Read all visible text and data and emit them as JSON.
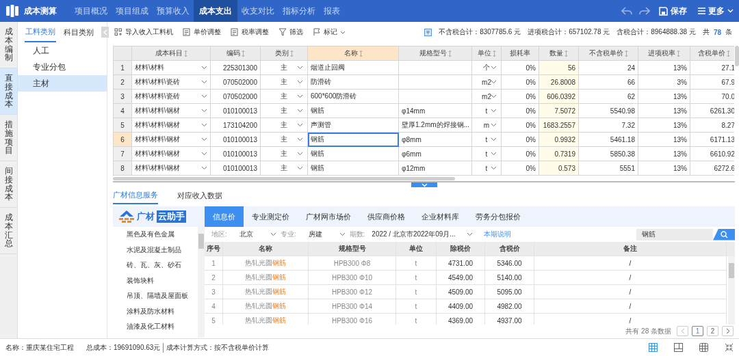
{
  "app": {
    "title": "成本测算"
  },
  "nav": [
    {
      "label": "项目概况",
      "selected": false
    },
    {
      "label": "项目组成",
      "selected": false
    },
    {
      "label": "预算收入",
      "selected": false
    },
    {
      "label": "成本支出",
      "selected": true
    },
    {
      "label": "收支对比",
      "selected": false
    },
    {
      "label": "指标分析",
      "selected": false
    },
    {
      "label": "报表",
      "selected": false
    }
  ],
  "actions": {
    "save": "保存",
    "more": "更多"
  },
  "side_tabs": [
    {
      "label": "成本编制",
      "selected": false
    },
    {
      "label": "直接成本",
      "selected": true
    },
    {
      "label": "措施项目",
      "selected": false
    },
    {
      "label": "间接成本",
      "selected": false
    },
    {
      "label": "成本汇总",
      "selected": false
    }
  ],
  "category_tabs": [
    {
      "label": "工料类别",
      "selected": true
    },
    {
      "label": "科目类别",
      "selected": false
    }
  ],
  "categories": [
    {
      "label": "人工",
      "selected": false
    },
    {
      "label": "专业分包",
      "selected": false
    },
    {
      "label": "主材",
      "selected": true
    }
  ],
  "toolbar": [
    {
      "label": "导入收入工料机",
      "kind": "import"
    },
    {
      "label": "单价调整",
      "kind": "doc"
    },
    {
      "label": "税率调整",
      "kind": "doc"
    },
    {
      "label": "筛选",
      "kind": "filter"
    },
    {
      "label": "标记",
      "kind": "flag"
    }
  ],
  "totals": [
    "不含税合计：8307785.6 元",
    "进项税合计：657102.78 元",
    "含税合计：8964888.38 元"
  ],
  "count": {
    "prefix": "共",
    "value": "78",
    "suffix": "条"
  },
  "table": {
    "columns": [
      {
        "label": "成本科目",
        "kind": "select",
        "sortable": true,
        "selected": false,
        "tinted": false
      },
      {
        "label": "编码",
        "kind": "number",
        "sortable": true,
        "selected": false,
        "tinted": false
      },
      {
        "label": "类别",
        "kind": "choice",
        "sortable": true,
        "selected": false,
        "tinted": false
      },
      {
        "label": "名称",
        "kind": "text",
        "sortable": true,
        "selected": true,
        "tinted": false
      },
      {
        "label": "规格型号",
        "kind": "text",
        "sortable": true,
        "selected": false,
        "tinted": false
      },
      {
        "label": "单位",
        "kind": "choice",
        "sortable": true,
        "selected": false,
        "tinted": false
      },
      {
        "label": "损耗率",
        "kind": "number",
        "sortable": false,
        "selected": false,
        "tinted": false
      },
      {
        "label": "数量",
        "kind": "number",
        "sortable": true,
        "selected": false,
        "tinted": true
      },
      {
        "label": "不含税单价",
        "kind": "number",
        "sortable": true,
        "selected": false,
        "tinted": false
      },
      {
        "label": "进项税率",
        "kind": "number",
        "sortable": true,
        "selected": false,
        "tinted": false
      },
      {
        "label": "含税单价",
        "kind": "number",
        "sortable": true,
        "selected": false,
        "tinted": false
      }
    ],
    "rows": [
      {
        "no": "1",
        "selected": false,
        "cells": [
          "材料\\材料",
          "225301300",
          "主",
          "烟道止回阀",
          null,
          "个",
          "0%",
          "56",
          "24",
          "13%",
          "27.1"
        ]
      },
      {
        "no": "2",
        "selected": false,
        "cells": [
          "材料\\材料\\瓷砖",
          "070502000",
          "主",
          "防滑砖",
          null,
          "m2",
          "0%",
          "26.8008",
          "66",
          "3%",
          "67.9"
        ]
      },
      {
        "no": "3",
        "selected": false,
        "cells": [
          "材料\\材料\\瓷砖",
          "070502000",
          "主",
          "600*600防滑砖",
          null,
          "m2",
          "0%",
          "606.0392",
          "62",
          "13%",
          "70.0"
        ]
      },
      {
        "no": "4",
        "selected": false,
        "cells": [
          "材料\\材料\\钢材",
          "010100013",
          "主",
          "钢筋",
          "φ14mm",
          "t",
          "0%",
          "7.5072",
          "5540.98",
          "13%",
          "6261.30"
        ]
      },
      {
        "no": "5",
        "selected": false,
        "cells": [
          "材料\\材料\\钢材",
          "173104200",
          "主",
          "声测管",
          "壁厚1.2mm的焊接钢...",
          "m",
          "0%",
          "1683.2557",
          "7.32",
          "13%",
          "8.27"
        ]
      },
      {
        "no": "6",
        "selected": true,
        "cells": [
          "材料\\材料\\钢材",
          "010100013",
          "主",
          "钢筋",
          "φ8mm",
          "t",
          "0%",
          "0.9932",
          "5461.18",
          "13%",
          "6171.13"
        ]
      },
      {
        "no": "7",
        "selected": false,
        "cells": [
          "材料\\材料\\钢材",
          "010100013",
          "主",
          "钢筋",
          "φ6mm",
          "t",
          "0%",
          "0.7319",
          "5850.38",
          "13%",
          "6610.92"
        ]
      },
      {
        "no": "8",
        "selected": false,
        "cells": [
          "材料\\材料\\钢材",
          "010100013",
          "主",
          "钢筋",
          "φ12mm",
          "t",
          "0%",
          "0.573",
          "5551",
          "13%",
          "6272.6"
        ]
      }
    ]
  },
  "bottom_tabs": [
    {
      "label": "广材信息服务",
      "selected": true
    },
    {
      "label": "对应收入数据",
      "selected": false
    }
  ],
  "brand": {
    "part1": "广材",
    "part2": "云助手"
  },
  "price_tabs": [
    {
      "label": "信息价",
      "selected": true
    },
    {
      "label": "专业测定价",
      "selected": false
    },
    {
      "label": "广材网市场价",
      "selected": false
    },
    {
      "label": "供应商价格",
      "selected": false
    },
    {
      "label": "企业材料库",
      "selected": false
    },
    {
      "label": "劳务分包报价",
      "selected": false
    }
  ],
  "material_categories": [
    "黑色及有色金属",
    "水泥及混凝土制品",
    "砖、瓦、灰、砂石",
    "装饰块料",
    "吊顶、隔墙及屋面板",
    "涂料及防水材料",
    "油漆及化工材料"
  ],
  "filters": [
    {
      "label": "地区:",
      "value": "北京"
    },
    {
      "label": "专业:",
      "value": "房建"
    },
    {
      "label": "期数:",
      "value": "2022 / 北京市2022年09月..."
    }
  ],
  "period_link": "本期说明",
  "search": {
    "value": "钢筋"
  },
  "price_table": {
    "columns": [
      "序号",
      "名称",
      "规格型号",
      "单位",
      "除税价",
      "含税价",
      "备注"
    ],
    "rows": [
      {
        "cells": [
          "1",
          "热轧光圆**钢筋**",
          "HPB300 Φ8",
          "t",
          "4731.00",
          "5346.00",
          "/"
        ]
      },
      {
        "cells": [
          "2",
          "热轧光圆**钢筋**",
          "HPB300 Φ10",
          "t",
          "4549.00",
          "5140.00",
          "/"
        ]
      },
      {
        "cells": [
          "3",
          "热轧光圆**钢筋**",
          "HPB300 Φ12",
          "t",
          "4509.00",
          "5095.00",
          "/"
        ]
      },
      {
        "cells": [
          "4",
          "热轧光圆**钢筋**",
          "HPB300 Φ14",
          "t",
          "4409.00",
          "4982.00",
          "/"
        ]
      },
      {
        "cells": [
          "5",
          "热轧光圆**钢筋**",
          "HPB300 Φ16",
          "t",
          "4369.00",
          "4937.00",
          "/"
        ]
      }
    ]
  },
  "pagination": {
    "summary": "共有 28 条数据",
    "pages": [
      {
        "label": "1",
        "selected": true
      },
      {
        "label": "2",
        "selected": false
      }
    ]
  },
  "status": [
    "名称：重庆某住宅工程",
    "总成本：19691090.63元",
    "成本计算方式：按不含税单价计算"
  ],
  "view_modes": [
    {
      "kind": "grid",
      "selected": true
    },
    {
      "kind": "split",
      "selected": false
    },
    {
      "kind": "tiles",
      "selected": false
    },
    {
      "kind": "collapse",
      "selected": false
    }
  ]
}
